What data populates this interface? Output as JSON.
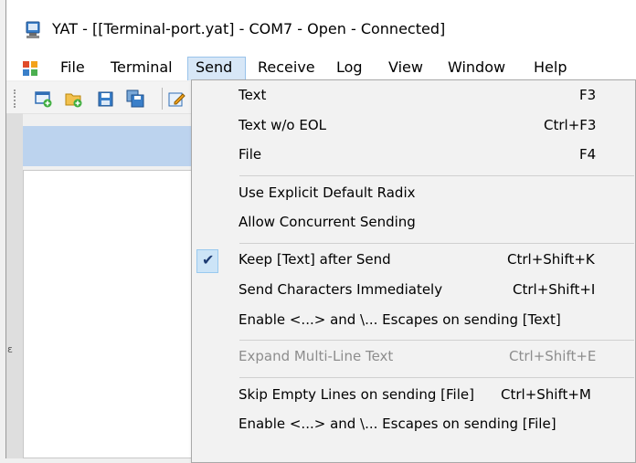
{
  "window": {
    "title": "YAT - [[Terminal-port.yat] - COM7 - Open - Connected]"
  },
  "menubar": {
    "items": [
      "File",
      "Terminal",
      "Send",
      "Receive",
      "Log",
      "View",
      "Window",
      "Help"
    ],
    "open_item": "Send"
  },
  "send_menu": {
    "items": [
      {
        "label": "Text",
        "shortcut": "F3",
        "checked": false,
        "enabled": true
      },
      {
        "label": "Text w/o EOL",
        "shortcut": "Ctrl+F3",
        "checked": false,
        "enabled": true
      },
      {
        "label": "File",
        "shortcut": "F4",
        "checked": false,
        "enabled": true
      },
      {
        "label": "Use Explicit Default Radix",
        "shortcut": "",
        "checked": false,
        "enabled": true
      },
      {
        "label": "Allow Concurrent Sending",
        "shortcut": "",
        "checked": false,
        "enabled": true
      },
      {
        "label": "Keep [Text] after Send",
        "shortcut": "Ctrl+Shift+K",
        "checked": true,
        "enabled": true
      },
      {
        "label": "Send Characters Immediately",
        "shortcut": "Ctrl+Shift+I",
        "checked": false,
        "enabled": true
      },
      {
        "label": "Enable <...> and \\... Escapes on sending [Text]",
        "shortcut": "",
        "checked": false,
        "enabled": true
      },
      {
        "label": "Expand Multi-Line Text",
        "shortcut": "Ctrl+Shift+E",
        "checked": false,
        "enabled": false
      },
      {
        "label": "Skip Empty Lines on sending [File]",
        "shortcut": "Ctrl+Shift+M",
        "checked": false,
        "enabled": true
      },
      {
        "label": "Enable <...> and \\... Escapes on sending [File]",
        "shortcut": "",
        "checked": false,
        "enabled": true
      }
    ]
  },
  "icons": {
    "app": "yat-app-icon",
    "toolbar": [
      "new-terminal-icon",
      "open-folder-icon",
      "save-icon",
      "save-all-icon",
      "edit-icon"
    ]
  },
  "colors": {
    "menu_highlight": "#d7e7f7",
    "panel_header": "#bcd3ee",
    "check_background": "#cce4f7",
    "disabled_text": "#8d8d8d"
  }
}
